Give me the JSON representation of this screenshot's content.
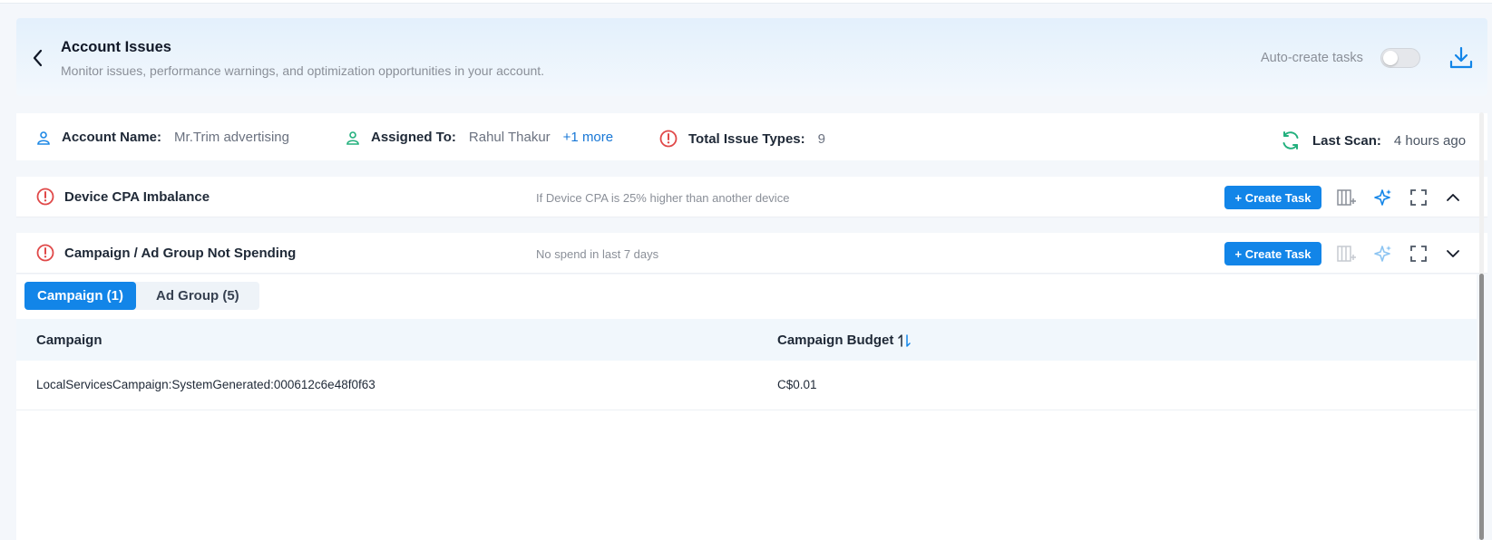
{
  "header": {
    "title": "Account Issues",
    "subtitle": "Monitor issues, performance warnings, and optimization opportunities in your account.",
    "auto_create_label": "Auto-create tasks",
    "auto_create_enabled": false
  },
  "info_bar": {
    "account_name_label": "Account Name:",
    "account_name_value": "Mr.Trim advertising",
    "assigned_to_label": "Assigned To:",
    "assigned_to_value": "Rahul Thakur",
    "assigned_more": "+1 more",
    "total_issue_types_label": "Total Issue Types:",
    "total_issue_types_value": "9",
    "last_scan_label": "Last Scan:",
    "last_scan_value": "4 hours ago"
  },
  "issues": [
    {
      "title": "Device CPA Imbalance",
      "description": "If Device CPA is 25% higher than another device",
      "create_task_label": "+ Create Task",
      "expanded": false
    },
    {
      "title": "Campaign / Ad Group Not Spending",
      "description": "No spend in last 7 days",
      "create_task_label": "+ Create Task",
      "expanded": true
    }
  ],
  "panel": {
    "tabs": [
      {
        "label": "Campaign (1)",
        "active": true
      },
      {
        "label": "Ad Group (5)",
        "active": false
      }
    ],
    "columns": [
      "Campaign",
      "Campaign Budget"
    ],
    "rows": [
      {
        "campaign": "LocalServicesCampaign:SystemGenerated:000612c6e48f0f63",
        "budget": "C$0.01"
      }
    ]
  },
  "colors": {
    "accent": "#1285e8",
    "error": "#e04848",
    "success": "#22b07d",
    "account_icon": "#1e88e5"
  },
  "icons": {
    "back": "chevron-left-icon",
    "download": "download-icon",
    "account": "user-icon",
    "assigned": "user-icon",
    "issues": "alert-circle-icon",
    "scan": "refresh-icon",
    "columns": "column-add-icon",
    "ai": "sparkle-icon",
    "expand": "fullscreen-icon",
    "collapse": "chevron-up-icon",
    "expand_row": "chevron-down-icon",
    "sort": "sort-icon"
  }
}
